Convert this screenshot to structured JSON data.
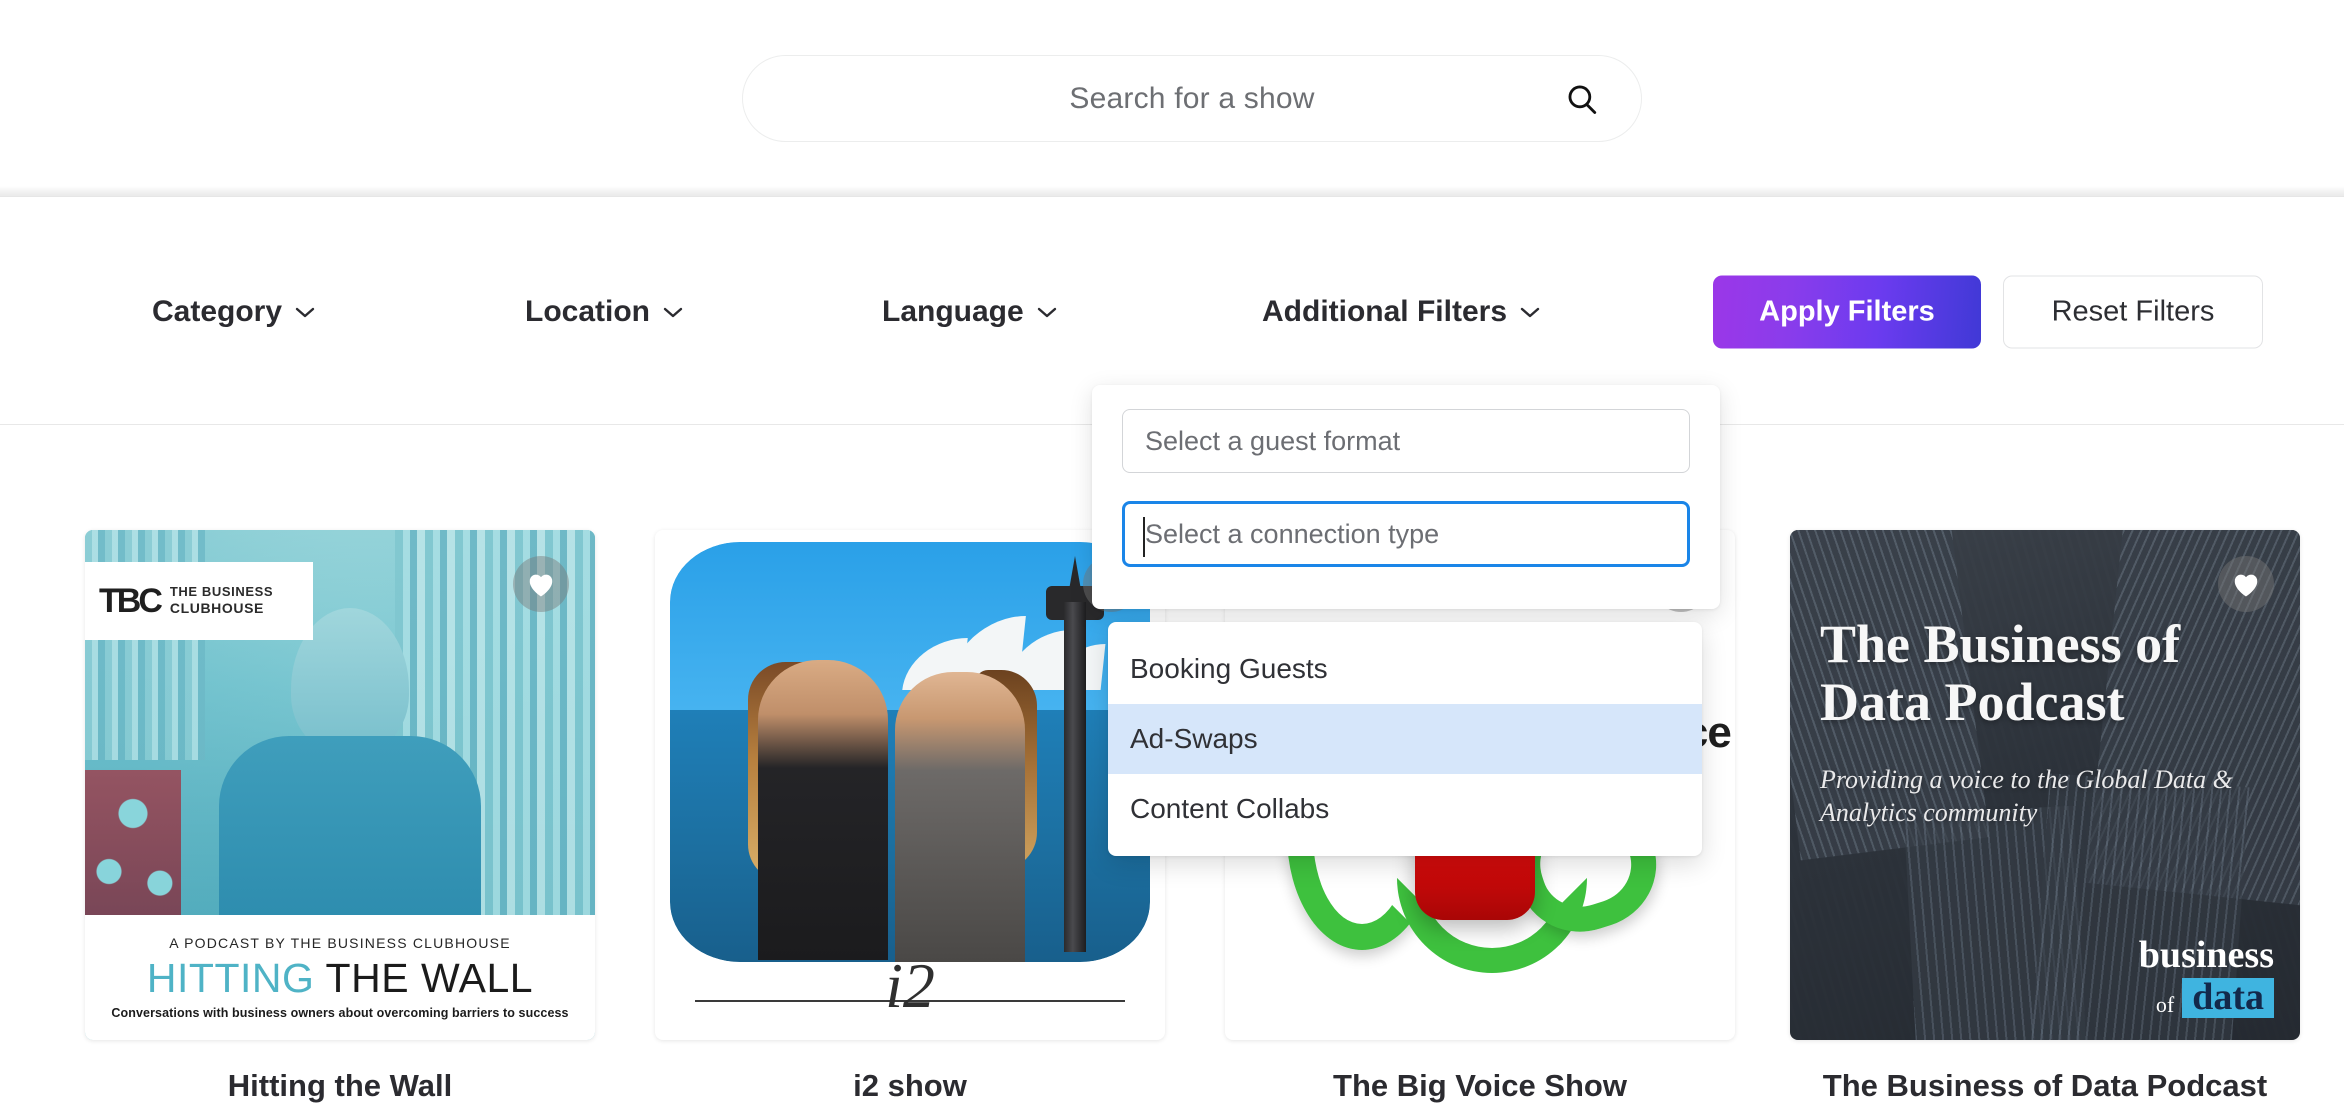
{
  "search": {
    "placeholder": "Search for a show",
    "icon": "search-icon"
  },
  "filters": {
    "items": [
      {
        "label": "Category",
        "icon": "chevron-down-icon"
      },
      {
        "label": "Location",
        "icon": "chevron-down-icon"
      },
      {
        "label": "Language",
        "icon": "chevron-down-icon"
      },
      {
        "label": "Additional Filters",
        "icon": "chevron-down-icon"
      }
    ],
    "apply_label": "Apply Filters",
    "reset_label": "Reset Filters",
    "apply_gradient_start": "#9b37e8",
    "apply_gradient_end": "#4039d6",
    "reset_bg": "#ffffff",
    "reset_border": "#e2e3e5"
  },
  "additional_filters_panel": {
    "guest_format": {
      "placeholder": "Select a guest format",
      "value": ""
    },
    "connection_type": {
      "placeholder": "Select a connection type",
      "value": "",
      "focused": true,
      "focus_border_color": "#1a85e8"
    },
    "options": [
      {
        "label": "Booking Guests",
        "highlighted": false
      },
      {
        "label": "Ad-Swaps",
        "highlighted": true
      },
      {
        "label": "Content Collabs",
        "highlighted": false
      }
    ],
    "highlight_color": "#d6e6fa"
  },
  "results": {
    "cards": [
      {
        "title": "Hitting the Wall",
        "favorite_icon": "heart-icon",
        "cover": {
          "logo_mark": "TBC",
          "logo_line1": "THE BUSINESS",
          "logo_line2": "CLUBHOUSE",
          "kicker": "A PODCAST BY THE BUSINESS CLUBHOUSE",
          "title_highlight": "HITTING",
          "title_rest": "THE WALL",
          "tagline": "Conversations with business owners about overcoming barriers to success"
        }
      },
      {
        "title": "i2 show",
        "favorite_icon": "heart-icon",
        "cover": {
          "wordmark": "i2"
        }
      },
      {
        "title": "The Big Voice Show",
        "favorite_icon": "heart-icon",
        "cover": {
          "wordmark": "e Voice"
        }
      },
      {
        "title": "The Business of Data Podcast",
        "favorite_icon": "heart-icon",
        "cover": {
          "title": "The Business of Data Podcast",
          "subtitle": "Providing a voice to the Global Data & Analytics community",
          "brand_line1": "business",
          "brand_line2": "of",
          "brand_line3": "data",
          "brand_accent": "#3fb4e0"
        }
      }
    ]
  }
}
